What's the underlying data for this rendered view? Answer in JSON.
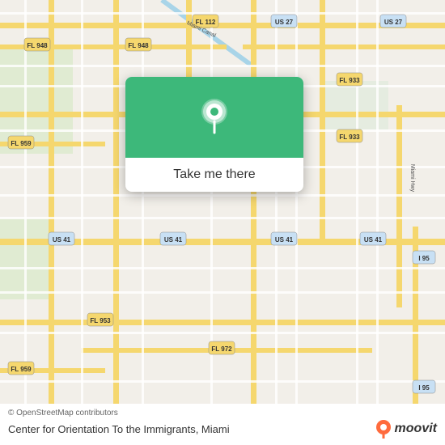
{
  "map": {
    "background_color": "#f2efe9",
    "road_color": "#ffffff",
    "major_road_color": "#f5d76e"
  },
  "popup": {
    "background_color": "#3db87a",
    "button_label": "Take me there"
  },
  "bottom_bar": {
    "attribution": "© OpenStreetMap contributors",
    "location_name": "Center for Orientation To the Immigrants, Miami",
    "logo_text": "moovit"
  },
  "road_labels": [
    "FL 112",
    "FL 948",
    "US 27",
    "FL 933",
    "FL 953",
    "FL 959",
    "US 41",
    "FL 972",
    "FL 953",
    "FL 959",
    "I 95",
    "I 95"
  ]
}
